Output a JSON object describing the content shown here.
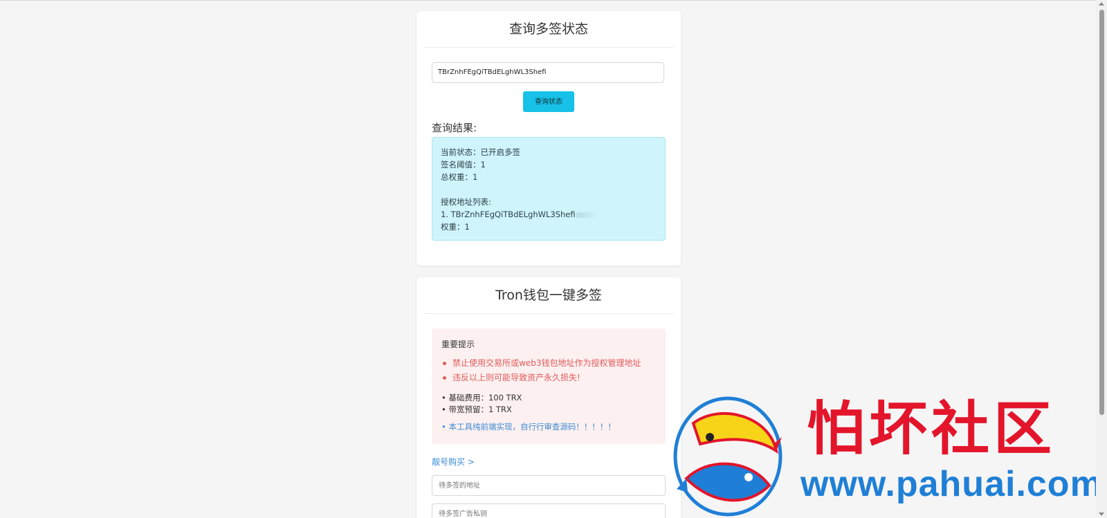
{
  "query_card": {
    "title": "查询多签状态",
    "address_value": "TBrZnhFEgQiTBdELghWL3Shefi",
    "query_button_label": "查询状态",
    "result_label": "查询结果:",
    "result": {
      "status_line": "当前状态：已开启多签",
      "threshold_line": "签名阈值：1",
      "total_weight_line": "总权重：1",
      "auth_list_label": "授权地址列表:",
      "auth_item_1": "1. TBrZnhFEgQiTBdELghWL3Shefi",
      "auth_item_1_weight": "权重：1"
    }
  },
  "multisig_card": {
    "title": "Tron钱包一键多签",
    "notice": {
      "title": "重要提示",
      "warnings": [
        "禁止使用交易所或web3钱包地址作为授权管理地址",
        "违反以上则可能导致资产永久损失!"
      ],
      "base_fee": "• 基础费用：100 TRX",
      "bandwidth_reserve": "• 带宽预留：1 TRX",
      "frontend_note": "• 本工具纯前端实现，自行行审查源码！！！！！"
    },
    "buy_link": "靓号购买 >",
    "address_placeholder": "待多签的地址",
    "private_key_placeholder": "待多签广告私钥"
  },
  "watermark": {
    "brand_cn": "怕坏社区",
    "brand_url": "www.pahuai.com",
    "brand_red": "#e3152b",
    "brand_blue": "#1f7fd6"
  },
  "colors": {
    "accent_button": "#17c1e8",
    "result_bg": "#cff4fb",
    "warning_bg": "#fdf0f0",
    "warning_text": "#e05a5a",
    "link": "#3a8bd6"
  }
}
